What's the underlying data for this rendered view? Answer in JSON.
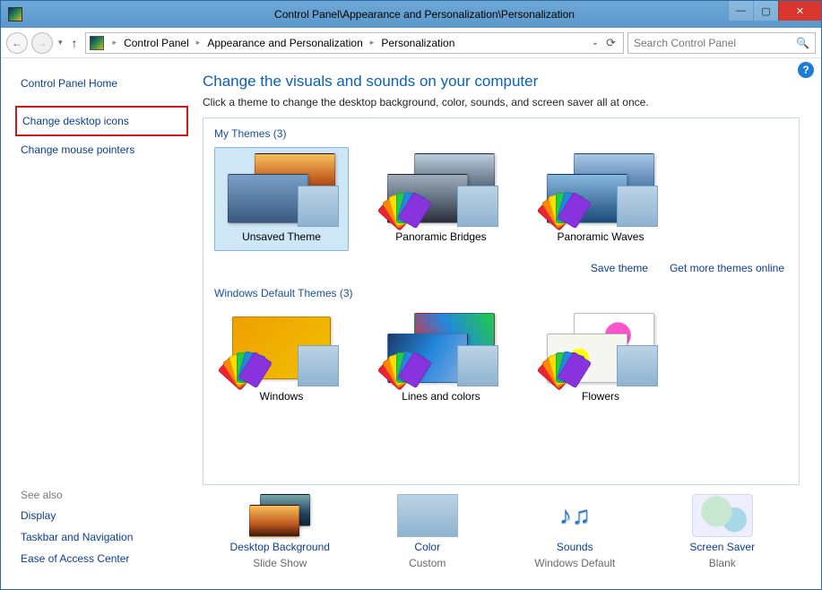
{
  "window": {
    "title": "Control Panel\\Appearance and Personalization\\Personalization"
  },
  "breadcrumb": {
    "items": [
      "Control Panel",
      "Appearance and Personalization",
      "Personalization"
    ]
  },
  "search": {
    "placeholder": "Search Control Panel"
  },
  "sidebar": {
    "home": "Control Panel Home",
    "links": [
      "Change desktop icons",
      "Change mouse pointers"
    ],
    "see_also_hdr": "See also",
    "see_also": [
      "Display",
      "Taskbar and Navigation",
      "Ease of Access Center"
    ]
  },
  "page": {
    "heading": "Change the visuals and sounds on your computer",
    "sub": "Click a theme to change the desktop background, color, sounds, and screen saver all at once."
  },
  "groups": [
    {
      "title": "My Themes (3)",
      "themes": [
        "Unsaved Theme",
        "Panoramic Bridges",
        "Panoramic Waves"
      ],
      "links": [
        "Save theme",
        "Get more themes online"
      ]
    },
    {
      "title": "Windows Default Themes (3)",
      "themes": [
        "Windows",
        "Lines and colors",
        "Flowers"
      ]
    }
  ],
  "bottom": {
    "items": [
      {
        "label": "Desktop Background",
        "value": "Slide Show"
      },
      {
        "label": "Color",
        "value": "Custom"
      },
      {
        "label": "Sounds",
        "value": "Windows Default"
      },
      {
        "label": "Screen Saver",
        "value": "Blank"
      }
    ]
  }
}
